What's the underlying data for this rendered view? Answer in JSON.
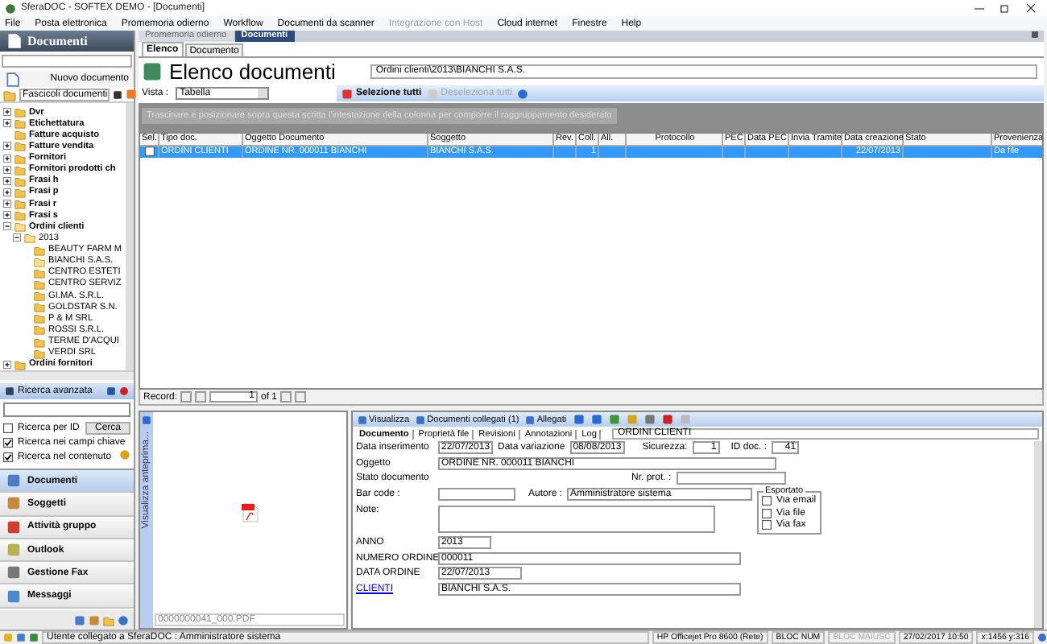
{
  "window": {
    "title": "SferaDOC - SOFTEX DEMO - [Documenti]"
  },
  "menu": [
    {
      "label": "File",
      "disabled": false
    },
    {
      "label": "Posta elettronica",
      "disabled": false
    },
    {
      "label": "Promemoria odierno",
      "disabled": false
    },
    {
      "label": "Workflow",
      "disabled": false
    },
    {
      "label": "Documenti da scanner",
      "disabled": false
    },
    {
      "label": "Integrazione con Host",
      "disabled": true
    },
    {
      "label": "Cloud internet",
      "disabled": false
    },
    {
      "label": "Finestre",
      "disabled": false
    },
    {
      "label": "Help",
      "disabled": false
    }
  ],
  "sidebar": {
    "title": "Documenti",
    "new_button": "Nuovo documento",
    "folder_selector": "Fascicoli documenti",
    "tree": [
      {
        "label": "Dvr",
        "has_expander": true,
        "expanded": false
      },
      {
        "label": "Etichettatura",
        "has_expander": true,
        "expanded": false
      },
      {
        "label": "Fatture acquisto",
        "has_expander": false,
        "expanded": false
      },
      {
        "label": "Fatture vendita",
        "has_expander": true,
        "expanded": false
      },
      {
        "label": "Fornitori",
        "has_expander": true,
        "expanded": false
      },
      {
        "label": "Fornitori prodotti ch",
        "has_expander": true,
        "expanded": false
      },
      {
        "label": "Frasi h",
        "has_expander": true,
        "expanded": false
      },
      {
        "label": "Frasi p",
        "has_expander": true,
        "expanded": false
      },
      {
        "label": "Frasi r",
        "has_expander": true,
        "expanded": false
      },
      {
        "label": "Frasi s",
        "has_expander": true,
        "expanded": false
      },
      {
        "label": "Ordini clienti",
        "has_expander": true,
        "expanded": true,
        "children": [
          {
            "label": "2013",
            "has_expander": true,
            "expanded": true,
            "children": [
              {
                "label": "BEAUTY FARM M",
                "has_expander": false,
                "expanded": false
              },
              {
                "label": "BIANCHI S.A.S.",
                "has_expander": false,
                "expanded": true
              },
              {
                "label": "CENTRO ESTETI",
                "has_expander": false,
                "expanded": false
              },
              {
                "label": "CENTRO SERVIZ",
                "has_expander": false,
                "expanded": false
              },
              {
                "label": "GI.MA. S.R.L.",
                "has_expander": false,
                "expanded": false
              },
              {
                "label": "GOLDSTAR S.N.",
                "has_expander": false,
                "expanded": false
              },
              {
                "label": "P & M SRL",
                "has_expander": false,
                "expanded": false
              },
              {
                "label": "ROSSI S.R.L.",
                "has_expander": false,
                "expanded": false
              },
              {
                "label": "TERME D'ACQUI",
                "has_expander": false,
                "expanded": false
              },
              {
                "label": "VERDI SRL",
                "has_expander": false,
                "expanded": false
              }
            ]
          }
        ]
      },
      {
        "label": "Ordini fornitori",
        "has_expander": true,
        "expanded": false
      }
    ],
    "advanced_search": "Ricerca avanzata",
    "search_button": "Cerca",
    "search_options": [
      {
        "label": "Ricerca per ID",
        "checked": false
      },
      {
        "label": "Ricerca nei campi chiave",
        "checked": true
      },
      {
        "label": "Ricerca nel contenuto",
        "checked": true
      }
    ],
    "nav": [
      {
        "label": "Documenti",
        "selected": true
      },
      {
        "label": "Soggetti",
        "selected": false
      },
      {
        "label": "Attività gruppo",
        "selected": false
      },
      {
        "label": "Outlook",
        "selected": false
      },
      {
        "label": "Gestione Fax",
        "selected": false
      },
      {
        "label": "Messaggi",
        "selected": false
      }
    ]
  },
  "tabs": [
    {
      "label": "Promemoria odierno",
      "selected": false
    },
    {
      "label": "Documenti",
      "selected": true
    }
  ],
  "subtabs": [
    {
      "label": "Elenco",
      "selected": true
    },
    {
      "label": "Documento",
      "selected": false
    }
  ],
  "list_title": "Elenco documenti",
  "path": "Ordini clienti\\2013\\BIANCHI S.A.S.",
  "toolbar": {
    "view_label": "Vista :",
    "view_value": "Tabella",
    "select_all": "Selezione tutti",
    "deselect_all": "Deseleziona tutti",
    "deselect_disabled": true
  },
  "group_hint": "Trascinare e posizionare sopra questa scritta l'intestazione della colonna per comporre il raggruppamento desiderato",
  "table": {
    "columns": [
      "Sel.",
      "Tipo doc.",
      "Oggetto Documento",
      "Soggetto",
      "Rev.",
      "Coll.",
      "All.",
      "Protocollo",
      "PEC",
      "Data PEC",
      "Invia Tramite",
      "Data creazione",
      "Stato",
      "Provenienza"
    ],
    "rows": [
      {
        "selected": true,
        "checked": false,
        "cells": [
          null,
          "ORDINI CLIENTI",
          "ORDINE NR. 000011 BIANCHI",
          "BIANCHI S.A.S.",
          null,
          "1",
          null,
          null,
          null,
          null,
          null,
          "22/07/2013",
          null,
          "Da file"
        ]
      }
    ]
  },
  "pager": {
    "label": "Record:",
    "value": "1",
    "total": "of 1"
  },
  "preview": {
    "label": "Visualizza anteprima...",
    "file": "0000000041_000.PDF"
  },
  "detail": {
    "toolbar": [
      "Visualizza",
      "Documenti collegati (1)",
      "Allegati"
    ],
    "tabs": [
      {
        "label": "Documento",
        "selected": true
      },
      {
        "label": "Proprietà file",
        "selected": false
      },
      {
        "label": "Revisioni",
        "selected": false
      },
      {
        "label": "Annotazioni",
        "selected": false
      },
      {
        "label": "Log",
        "selected": false
      }
    ],
    "type": "ORDINI CLIENTI",
    "data_inserimento": {
      "label": "Data inserimento",
      "value": "22/07/2013"
    },
    "data_variazione": {
      "label": "Data variazione",
      "value": "08/08/2013"
    },
    "sicurezza": {
      "label": "Sicurezza:",
      "value": "1"
    },
    "id_doc": {
      "label": "ID doc. :",
      "value": "41"
    },
    "oggetto": {
      "label": "Oggetto",
      "value": "ORDINE NR. 000011 BIANCHI"
    },
    "stato": {
      "label": "Stato documento"
    },
    "nr_prot": {
      "label": "Nr. prot. :"
    },
    "bar_code": {
      "label": "Bar code :"
    },
    "autore": {
      "label": "Autore :",
      "value": "Amministratore sistema"
    },
    "note": {
      "label": "Note:"
    },
    "exported": {
      "title": "Esportato",
      "options": [
        {
          "label": "Via email",
          "checked": false
        },
        {
          "label": "Via file",
          "checked": false
        },
        {
          "label": "Via fax",
          "checked": false
        }
      ]
    },
    "extra": [
      {
        "label": "ANNO",
        "value": "2013",
        "kind": "text"
      },
      {
        "label": "NUMERO ORDINE",
        "value": "000011",
        "kind": "text"
      },
      {
        "label": "DATA ORDINE",
        "value": "22/07/2013",
        "kind": "text"
      },
      {
        "label": "CLIENTI",
        "value": "BIANCHI S.A.S.",
        "kind": "link"
      }
    ]
  },
  "status_bar": {
    "user": "Utente collegato a SferaDOC : Amministratore sistema",
    "panels": [
      {
        "label": "HP Officejet Pro 8600 (Rete)",
        "disabled": false
      },
      {
        "label": "BLOC NUM",
        "disabled": false
      },
      {
        "label": "BLOC MAIUSC",
        "disabled": true
      },
      {
        "label": "27/02/2017 10:50",
        "disabled": false
      },
      {
        "label": "x:1456 y:316",
        "disabled": false
      }
    ]
  }
}
